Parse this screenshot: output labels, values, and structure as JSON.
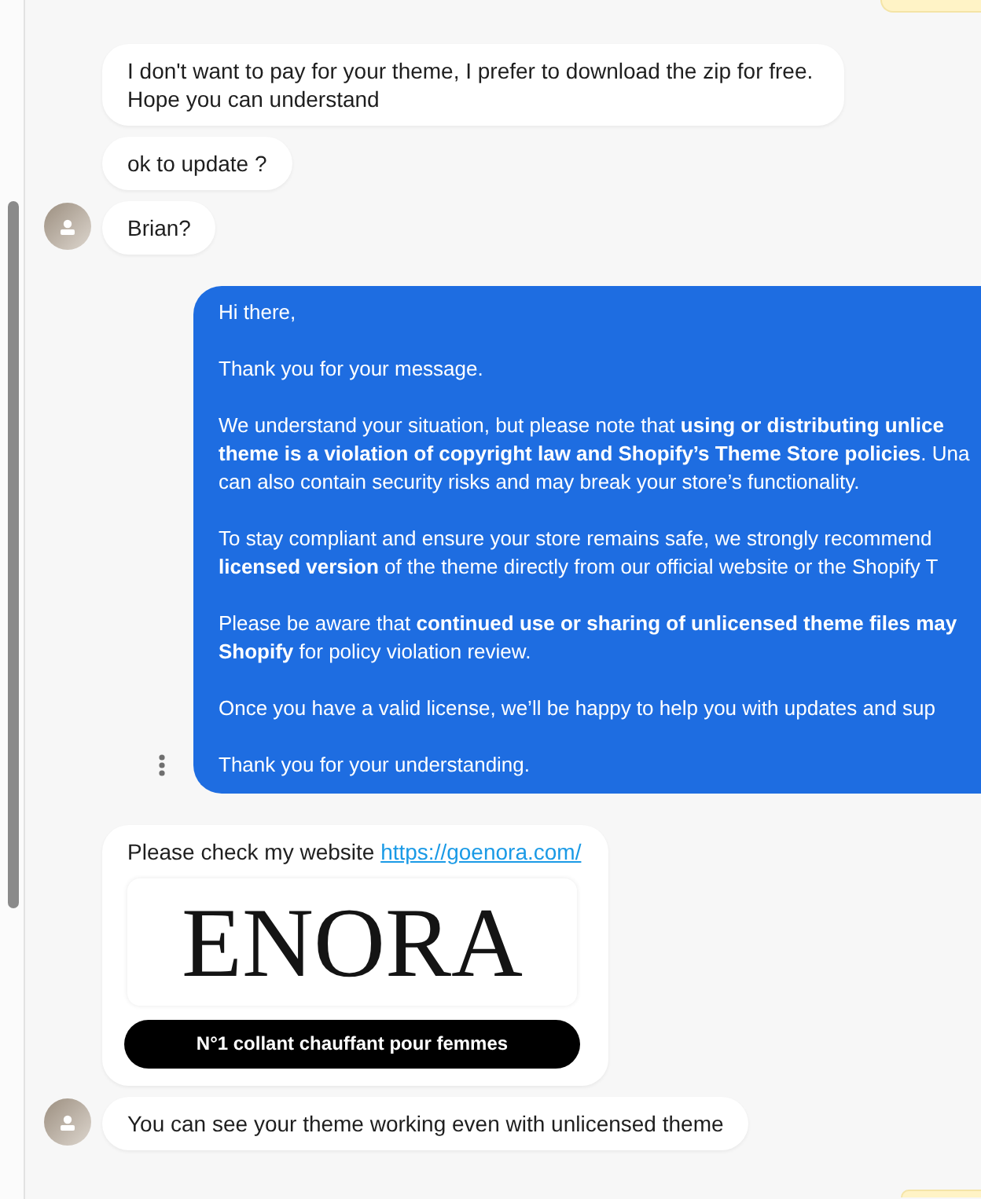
{
  "messages": [
    {
      "kind": "partial",
      "at_top": true
    },
    {
      "kind": "text",
      "text": "I don't want to pay for your theme, I prefer to download the zip for free. Hope you can understand",
      "show_avatar": false
    },
    {
      "kind": "text",
      "text": "ok to update ?",
      "show_avatar": false
    },
    {
      "kind": "text",
      "text": "Brian?",
      "show_avatar": true
    },
    {
      "kind": "outgoing",
      "paragraphs": [
        {
          "lines": [
            "Hi there,"
          ]
        },
        {
          "lines": [
            "Thank you for your message."
          ]
        },
        {
          "lines": [
            "We understand your situation, but please note that **using or distributing unlice**",
            "**theme is a violation of copyright law and Shopify’s Theme Store policies**. Una",
            "can also contain security risks and may break your store’s functionality."
          ]
        },
        {
          "lines": [
            "To stay compliant and ensure your store remains safe, we strongly recommend",
            "**licensed version** of the theme directly from our official website or the Shopify T"
          ]
        },
        {
          "lines": [
            "Please be aware that **continued use or sharing of unlicensed theme files may**",
            "**Shopify** for policy violation review."
          ]
        },
        {
          "lines": [
            "Once you have a valid license, we’ll be happy to help you with updates and sup"
          ]
        },
        {
          "lines": [
            "Thank you for your understanding."
          ]
        }
      ]
    },
    {
      "kind": "link_preview",
      "text": "Please check my website",
      "link": "https://goenora.com/",
      "preview": {
        "logo": "ENORA",
        "tagline": "N°1 collant chauffant pour femmes"
      },
      "show_avatar": false
    },
    {
      "kind": "text",
      "text": "You can see your theme working even with unlicensed theme",
      "show_avatar": true
    },
    {
      "kind": "partial",
      "at_top": false
    }
  ]
}
